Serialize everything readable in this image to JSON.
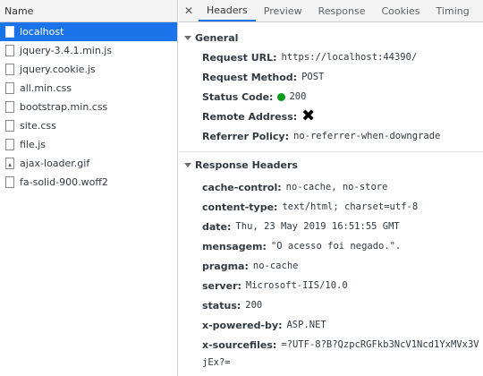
{
  "left": {
    "header": "Name",
    "files": [
      {
        "name": "localhost",
        "icon": "document-icon",
        "selected": true
      },
      {
        "name": "jquery-3.4.1.min.js",
        "icon": "document-icon"
      },
      {
        "name": "jquery.cookie.js",
        "icon": "document-icon"
      },
      {
        "name": "all.min.css",
        "icon": "document-icon"
      },
      {
        "name": "bootstrap.min.css",
        "icon": "document-icon"
      },
      {
        "name": "site.css",
        "icon": "document-icon"
      },
      {
        "name": "file.js",
        "icon": "document-icon"
      },
      {
        "name": "ajax-loader.gif",
        "icon": "image-icon"
      },
      {
        "name": "fa-solid-900.woff2",
        "icon": "document-icon"
      }
    ]
  },
  "tabs": {
    "close": "✕",
    "items": [
      "Headers",
      "Preview",
      "Response",
      "Cookies",
      "Timing"
    ],
    "active": "Headers"
  },
  "general": {
    "title": "General",
    "request_url_label": "Request URL:",
    "request_url": "https://localhost:44390/",
    "request_method_label": "Request Method:",
    "request_method": "POST",
    "status_code_label": "Status Code:",
    "status_code": "200",
    "status_color": "#0a9d1c",
    "remote_address_label": "Remote Address:",
    "referrer_policy_label": "Referrer Policy:",
    "referrer_policy": "no-referrer-when-downgrade"
  },
  "response": {
    "title": "Response Headers",
    "cache_control_label": "cache-control:",
    "cache_control": "no-cache, no-store",
    "content_type_label": "content-type:",
    "content_type": "text/html; charset=utf-8",
    "date_label": "date:",
    "date": "Thu, 23 May 2019 16:51:55 GMT",
    "mensagem_label": "mensagem:",
    "mensagem": "\"O acesso foi negado.\".",
    "pragma_label": "pragma:",
    "pragma": "no-cache",
    "server_label": "server:",
    "server": "Microsoft-IIS/10.0",
    "status_label": "status:",
    "status": "200",
    "x_powered_by_label": "x-powered-by:",
    "x_powered_by": "ASP.NET",
    "x_sourcefiles_label": "x-sourcefiles:",
    "x_sourcefiles": "=?UTF-8?B?QzpcRGFkb3NcV1Ncd1YxMVx3V",
    "x_sourcefiles_cont": "jEx?="
  },
  "colors": {
    "accent": "#1a73e8"
  }
}
